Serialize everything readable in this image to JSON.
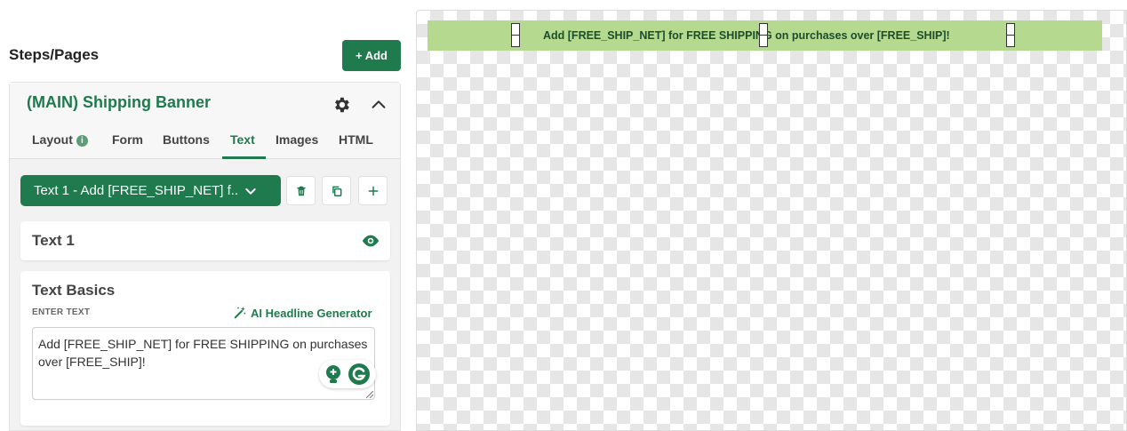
{
  "left_panel": {
    "steps_title": "Steps/Pages",
    "add_button": "+ Add",
    "card": {
      "title": "(MAIN) Shipping Banner",
      "tabs": [
        {
          "label": "Layout",
          "active": false
        },
        {
          "label": "Form",
          "active": false
        },
        {
          "label": "Buttons",
          "active": false
        },
        {
          "label": "Text",
          "active": true
        },
        {
          "label": "Images",
          "active": false
        },
        {
          "label": "HTML",
          "active": false
        }
      ],
      "text_selector": "Text 1 - Add [FREE_SHIP_NET] f..",
      "text_item_label": "Text 1",
      "basics": {
        "title": "Text Basics",
        "enter_text_label": "ENTER TEXT",
        "ai_link": "AI Headline Generator",
        "text_value": "Add [FREE_SHIP_NET] for FREE SHIPPING on purchases over [FREE_SHIP]!"
      }
    }
  },
  "canvas": {
    "banner_text": "Add [FREE_SHIP_NET] for FREE SHIPPING on purchases over [FREE_SHIP]!",
    "banner_color": "#b5da8f"
  },
  "colors": {
    "accent": "#1f7a4d",
    "panel_bg": "#f2f2f2"
  },
  "icons": [
    "gear-icon",
    "chevron-up-icon",
    "info-icon",
    "chevron-down-icon",
    "trash-icon",
    "copy-icon",
    "plus-icon",
    "eye-icon",
    "magic-wand-icon",
    "lightbulb-icon",
    "grammarly-icon",
    "resize-grip-icon"
  ]
}
